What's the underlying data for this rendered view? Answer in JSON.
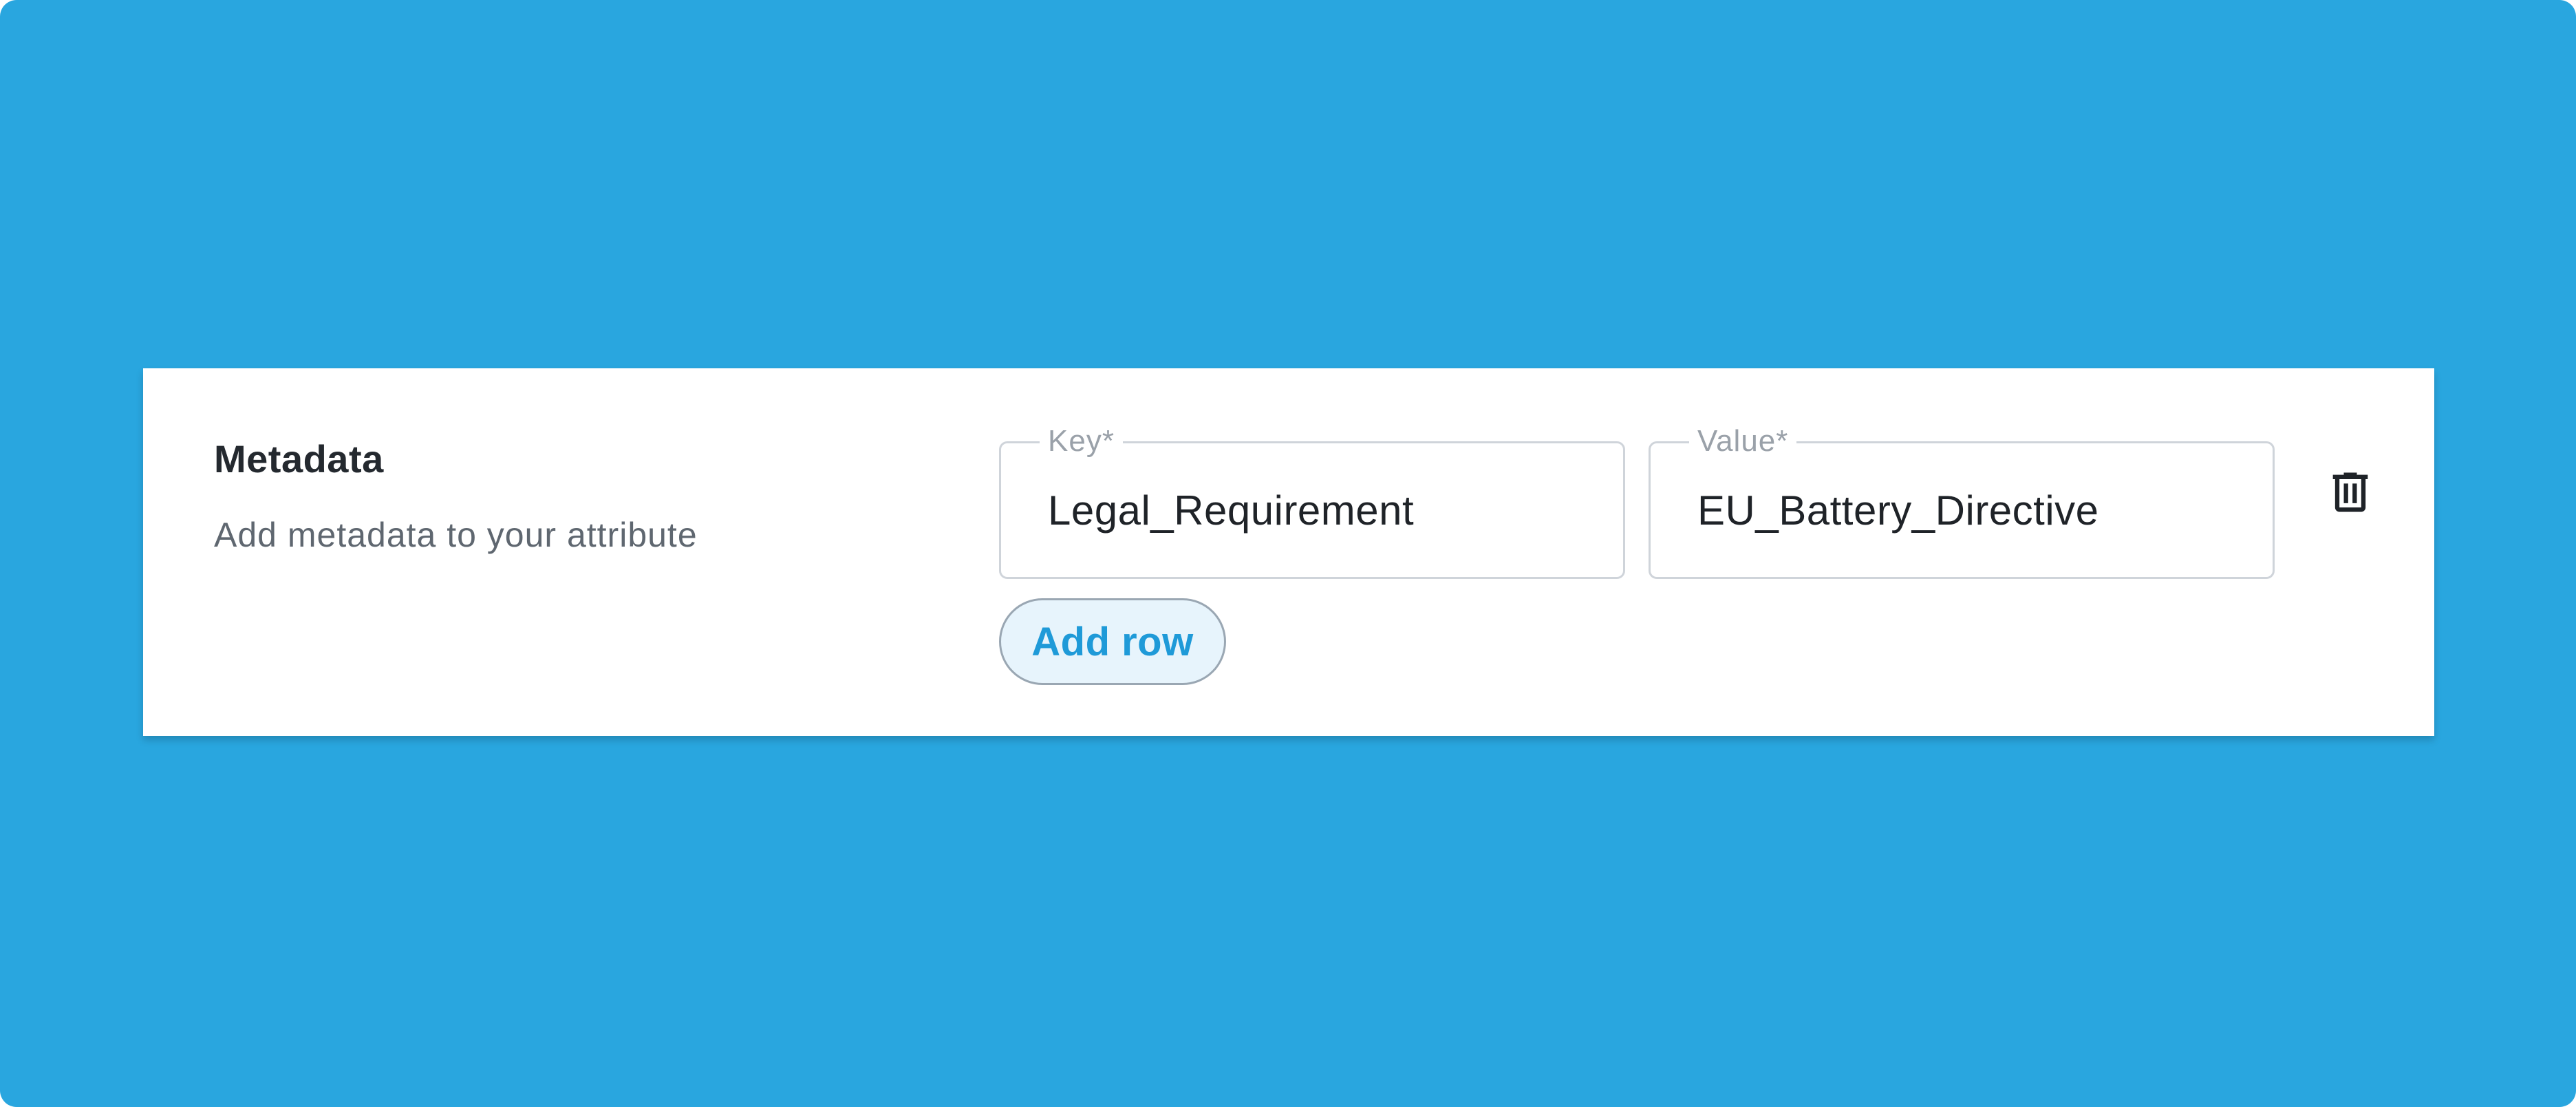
{
  "metadata_section": {
    "title": "Metadata",
    "description": "Add metadata to your attribute",
    "row": {
      "key_label": "Key*",
      "key_value": "Legal_Requirement",
      "value_label": "Value*",
      "value_value": "EU_Battery_Directive",
      "delete_icon": "trash-icon"
    },
    "add_row_label": "Add row"
  },
  "colors": {
    "background": "#29a6df",
    "card": "#ffffff",
    "accent": "#1f9ad8",
    "button_fill": "#e7f4fc"
  }
}
